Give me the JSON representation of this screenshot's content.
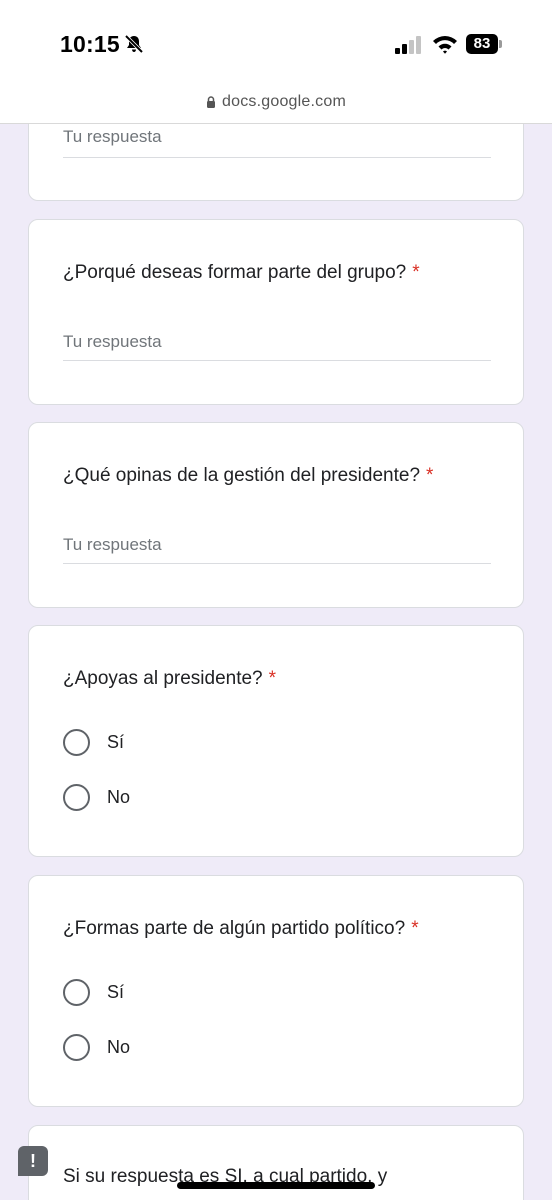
{
  "status_bar": {
    "time": "10:15",
    "battery": "83"
  },
  "browser": {
    "url": "docs.google.com"
  },
  "form": {
    "required_marker": "*",
    "top_partial": {
      "placeholder": "Tu respuesta"
    },
    "q1": {
      "question": "¿Porqué deseas formar parte del grupo?",
      "placeholder": "Tu respuesta"
    },
    "q2": {
      "question": "¿Qué opinas de la gestión del presidente?",
      "placeholder": "Tu respuesta"
    },
    "q3": {
      "question": "¿Apoyas al presidente?",
      "options": [
        "Sí",
        "No"
      ]
    },
    "q4": {
      "question": "¿Formas parte de algún partido político?",
      "options": [
        "Sí",
        "No"
      ]
    },
    "q5": {
      "question": "Si su respuesta es SI, a cual partido, y"
    }
  },
  "icons": {
    "bell": "bell-slash-icon",
    "signal": "cellular-signal-icon",
    "wifi": "wifi-icon",
    "lock": "lock-icon",
    "report": "report-problem-icon"
  },
  "report_label": "!"
}
